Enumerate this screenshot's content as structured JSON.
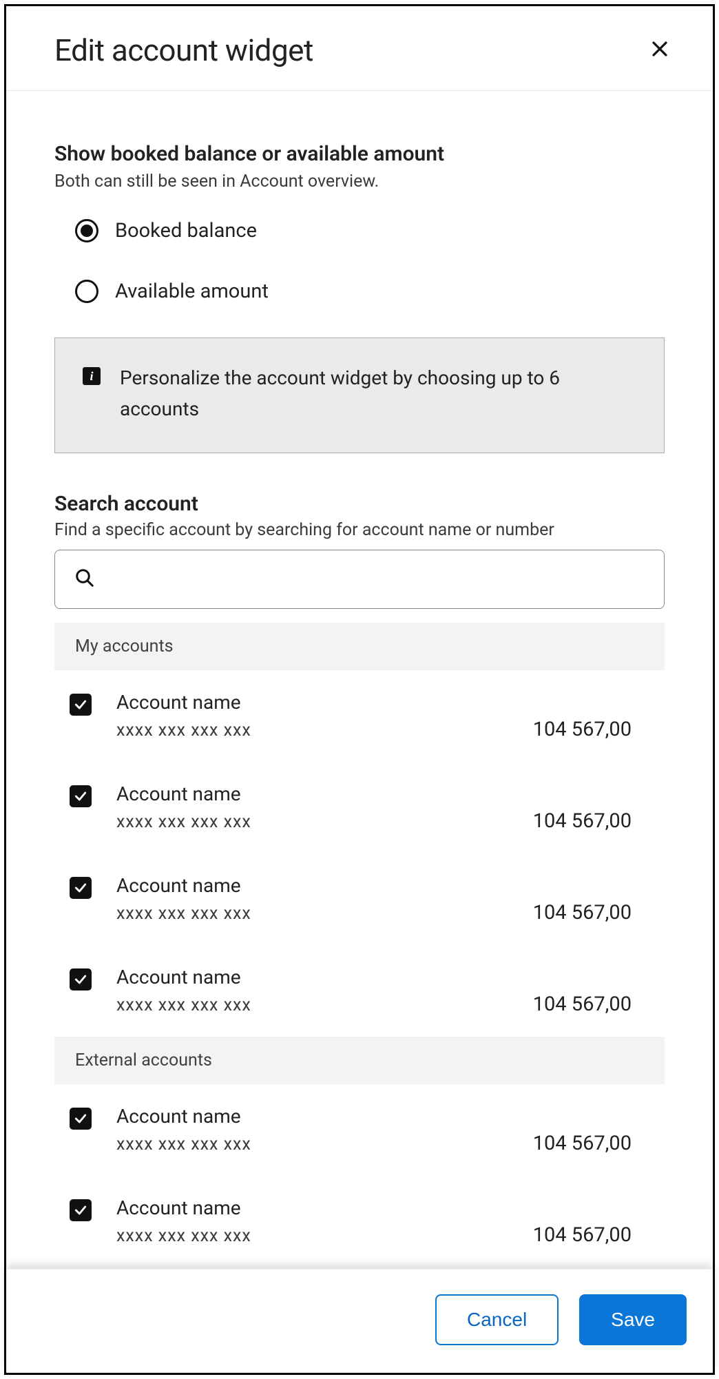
{
  "header": {
    "title": "Edit account widget"
  },
  "balance_section": {
    "title": "Show booked balance or available amount",
    "subtitle": "Both can still be seen in Account overview.",
    "options": {
      "booked": "Booked balance",
      "available": "Available amount"
    },
    "selected": "booked"
  },
  "info": {
    "text": "Personalize the account widget by choosing up to 6 accounts"
  },
  "search": {
    "label": "Search account",
    "sublabel": "Find a specific account by searching for account name or number",
    "value": ""
  },
  "groups": [
    {
      "label": "My accounts",
      "accounts": [
        {
          "name": "Account name",
          "number": "xxxx xxx xxx xxx",
          "balance": "104 567,00",
          "checked": true
        },
        {
          "name": "Account name",
          "number": "xxxx xxx xxx xxx",
          "balance": "104 567,00",
          "checked": true
        },
        {
          "name": "Account name",
          "number": "xxxx xxx xxx xxx",
          "balance": "104 567,00",
          "checked": true
        },
        {
          "name": "Account name",
          "number": "xxxx xxx xxx xxx",
          "balance": "104 567,00",
          "checked": true
        }
      ]
    },
    {
      "label": "External accounts",
      "accounts": [
        {
          "name": "Account name",
          "number": "xxxx xxx xxx xxx",
          "balance": "104 567,00",
          "checked": true
        },
        {
          "name": "Account name",
          "number": "xxxx xxx xxx xxx",
          "balance": "104 567,00",
          "checked": true
        }
      ]
    }
  ],
  "footer": {
    "cancel": "Cancel",
    "save": "Save"
  }
}
